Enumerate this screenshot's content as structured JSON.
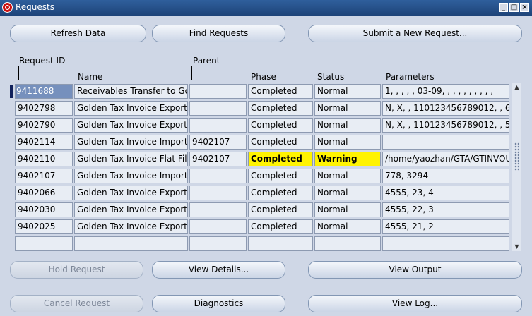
{
  "window": {
    "title": "Requests"
  },
  "toolbar": {
    "refresh": "Refresh Data",
    "find": "Find Requests",
    "submit": "Submit a New Request..."
  },
  "headers": {
    "request_id": "Request ID",
    "parent": "Parent",
    "name": "Name",
    "phase": "Phase",
    "status": "Status",
    "parameters": "Parameters"
  },
  "rows": [
    {
      "id": "9411688",
      "name": "Receivables Transfer to Go",
      "parent": "",
      "phase": "Completed",
      "status": "Normal",
      "parameters": "1, , , , , 03-09, , , , , , , , , ,"
    },
    {
      "id": "9402798",
      "name": "Golden Tax Invoice Export",
      "parent": "",
      "phase": "Completed",
      "status": "Normal",
      "parameters": "N, X, , 110123456789012, , 6,"
    },
    {
      "id": "9402790",
      "name": "Golden Tax Invoice Export",
      "parent": "",
      "phase": "Completed",
      "status": "Normal",
      "parameters": "N, X, , 110123456789012, , 5,"
    },
    {
      "id": "9402114",
      "name": "Golden Tax Invoice Import",
      "parent": "9402107",
      "phase": "Completed",
      "status": "Normal",
      "parameters": ""
    },
    {
      "id": "9402110",
      "name": "Golden Tax Invoice Flat File",
      "parent": "9402107",
      "phase": "Completed",
      "status": "Warning",
      "parameters": "/home/yaozhan/GTA/GTINVOU"
    },
    {
      "id": "9402107",
      "name": "Golden Tax Invoice Import (",
      "parent": "",
      "phase": "Completed",
      "status": "Normal",
      "parameters": "778, 3294"
    },
    {
      "id": "9402066",
      "name": "Golden Tax Invoice Export",
      "parent": "",
      "phase": "Completed",
      "status": "Normal",
      "parameters": "4555, 23, 4"
    },
    {
      "id": "9402030",
      "name": "Golden Tax Invoice Export",
      "parent": "",
      "phase": "Completed",
      "status": "Normal",
      "parameters": "4555, 22, 3"
    },
    {
      "id": "9402025",
      "name": "Golden Tax Invoice Export",
      "parent": "",
      "phase": "Completed",
      "status": "Normal",
      "parameters": "4555, 21, 2"
    },
    {
      "id": "",
      "name": "",
      "parent": "",
      "phase": "",
      "status": "",
      "parameters": ""
    }
  ],
  "bottom": {
    "hold": "Hold Request",
    "details": "View Details...",
    "output": "View Output",
    "cancel": "Cancel Request",
    "diagnostics": "Diagnostics",
    "log": "View Log..."
  }
}
